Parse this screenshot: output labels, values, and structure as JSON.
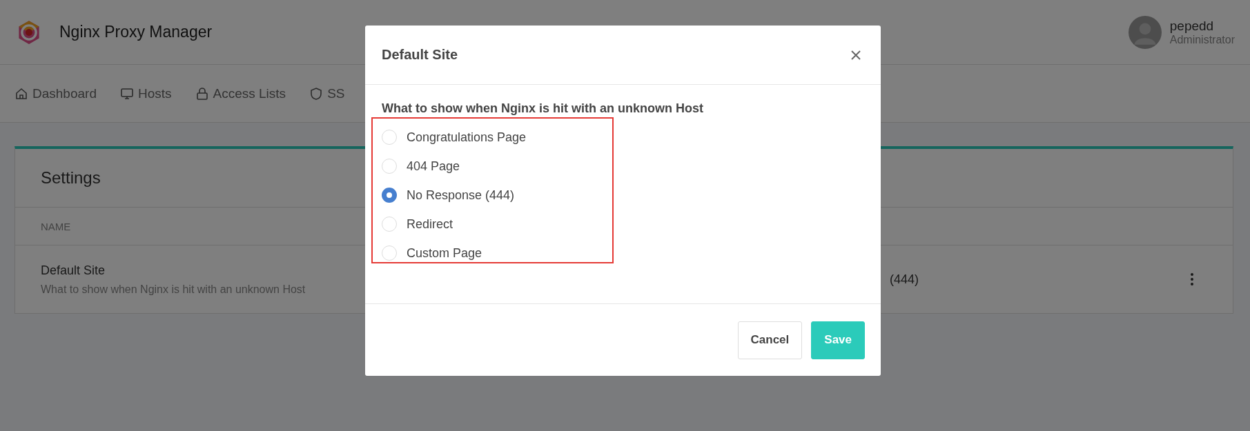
{
  "header": {
    "title": "Nginx Proxy Manager",
    "user": {
      "name": "pepedd",
      "role": "Administrator"
    }
  },
  "nav": [
    {
      "label": "Dashboard",
      "kind": "home"
    },
    {
      "label": "Hosts",
      "kind": "monitor"
    },
    {
      "label": "Access Lists",
      "kind": "lock"
    },
    {
      "label": "SS",
      "kind": "shield"
    }
  ],
  "settings_card": {
    "title": "Settings",
    "columns": [
      "NAME"
    ],
    "rows": [
      {
        "name": "Default Site",
        "description": "What to show when Nginx is hit with an unknown Host",
        "value": "(444)"
      }
    ]
  },
  "modal": {
    "title": "Default Site",
    "question": "What to show when Nginx is hit with an unknown Host",
    "options": [
      {
        "label": "Congratulations Page",
        "selected": false
      },
      {
        "label": "404 Page",
        "selected": false
      },
      {
        "label": "No Response (444)",
        "selected": true
      },
      {
        "label": "Redirect",
        "selected": false
      },
      {
        "label": "Custom Page",
        "selected": false
      }
    ],
    "buttons": [
      {
        "label": "Cancel",
        "kind": "secondary"
      },
      {
        "label": "Save",
        "kind": "primary"
      }
    ]
  }
}
